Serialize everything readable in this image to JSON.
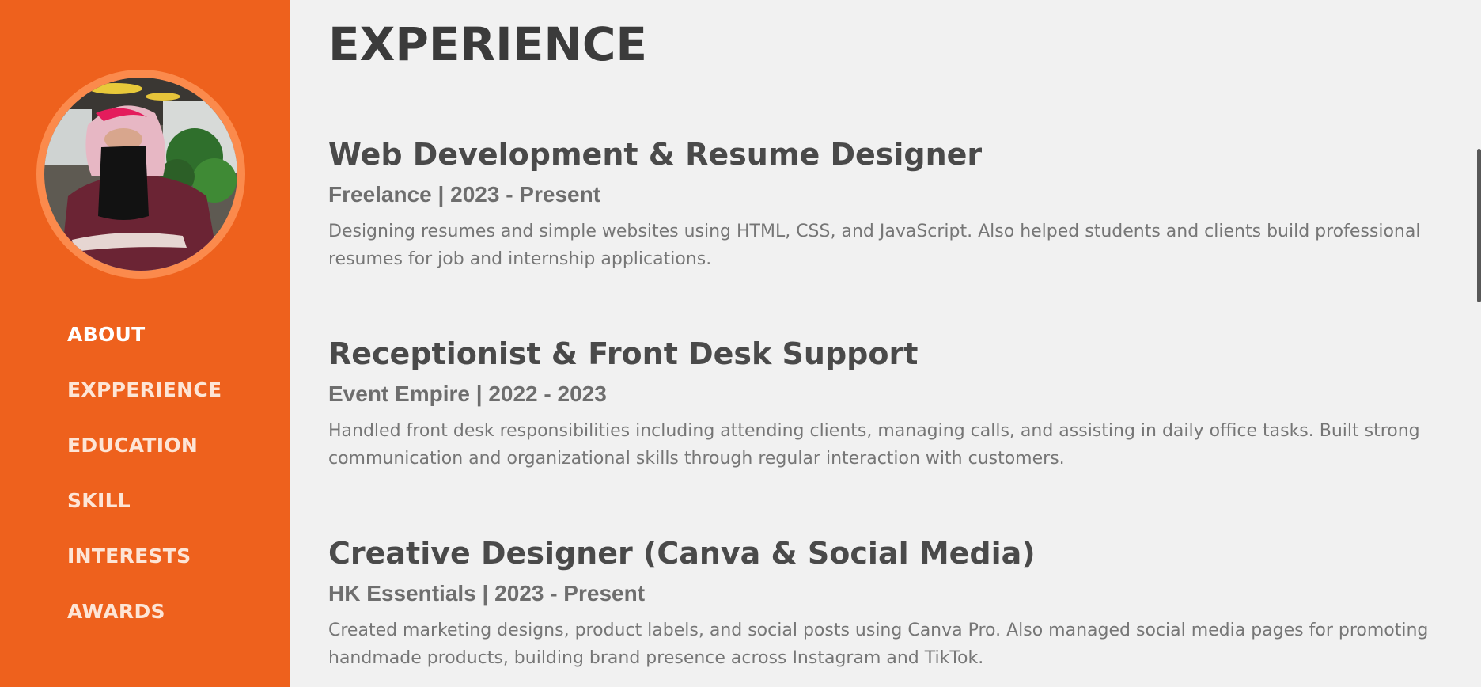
{
  "sidebar": {
    "avatar_alt": "profile photo",
    "nav": [
      {
        "label": "ABOUT"
      },
      {
        "label": "EXPPERIENCE"
      },
      {
        "label": "EDUCATION"
      },
      {
        "label": "SKILL"
      },
      {
        "label": "INTERESTS"
      },
      {
        "label": "AWARDS"
      }
    ]
  },
  "main": {
    "title": "EXPERIENCE",
    "jobs": [
      {
        "title": "Web Development & Resume Designer",
        "meta": "Freelance | 2023 - Present",
        "description": "Designing resumes and simple websites using HTML, CSS, and JavaScript. Also helped students and clients build professional resumes for job and internship applications."
      },
      {
        "title": "Receptionist & Front Desk Support",
        "meta": "Event Empire | 2022 - 2023",
        "description": "Handled front desk responsibilities including attending clients, managing calls, and assisting in daily office tasks. Built strong communication and organizational skills through regular interaction with customers."
      },
      {
        "title": "Creative Designer (Canva & Social Media)",
        "meta": "HK Essentials | 2023 - Present",
        "description": "Created marketing designs, product labels, and social posts using Canva Pro. Also managed social media pages for promoting handmade products, building brand presence across Instagram and TikTok."
      }
    ]
  },
  "colors": {
    "sidebar_bg": "#ee611d",
    "avatar_ring": "#fb8a4c",
    "page_bg": "#f1f1f1",
    "heading": "#3b3b3b",
    "body_text": "#767676"
  }
}
